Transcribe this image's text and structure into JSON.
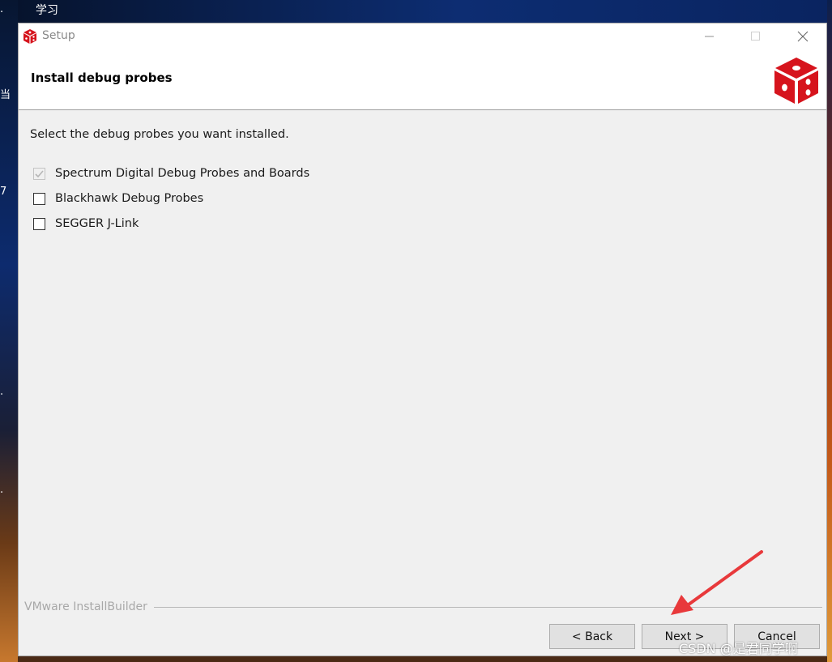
{
  "desktop": {
    "top_label": "学习",
    "left_fragments": [
      ".",
      "当",
      "7",
      ".",
      "."
    ]
  },
  "window": {
    "title": "Setup",
    "header_title": "Install debug probes",
    "prompt": "Select the debug probes you want installed.",
    "options": [
      {
        "label": "Spectrum Digital Debug Probes and Boards",
        "checked": true,
        "disabled": true
      },
      {
        "label": "Blackhawk Debug Probes",
        "checked": false,
        "disabled": false
      },
      {
        "label": "SEGGER J-Link",
        "checked": false,
        "disabled": false
      }
    ],
    "footer_brand": "VMware InstallBuilder",
    "buttons": {
      "back": "< Back",
      "next": "Next >",
      "cancel": "Cancel"
    }
  },
  "annotation": {
    "arrow_color": "#e8393b",
    "watermark": "CSDN @是君同学啊"
  },
  "colors": {
    "logo_red": "#d6141d",
    "window_bg": "#f0f0f0",
    "button_bg": "#e1e1e1"
  },
  "icons": {
    "title": "cube-logo-icon",
    "header": "cube-logo-icon",
    "minimize": "minimize-icon",
    "maximize": "maximize-icon",
    "close": "close-icon",
    "checked": "checkmark-icon"
  }
}
